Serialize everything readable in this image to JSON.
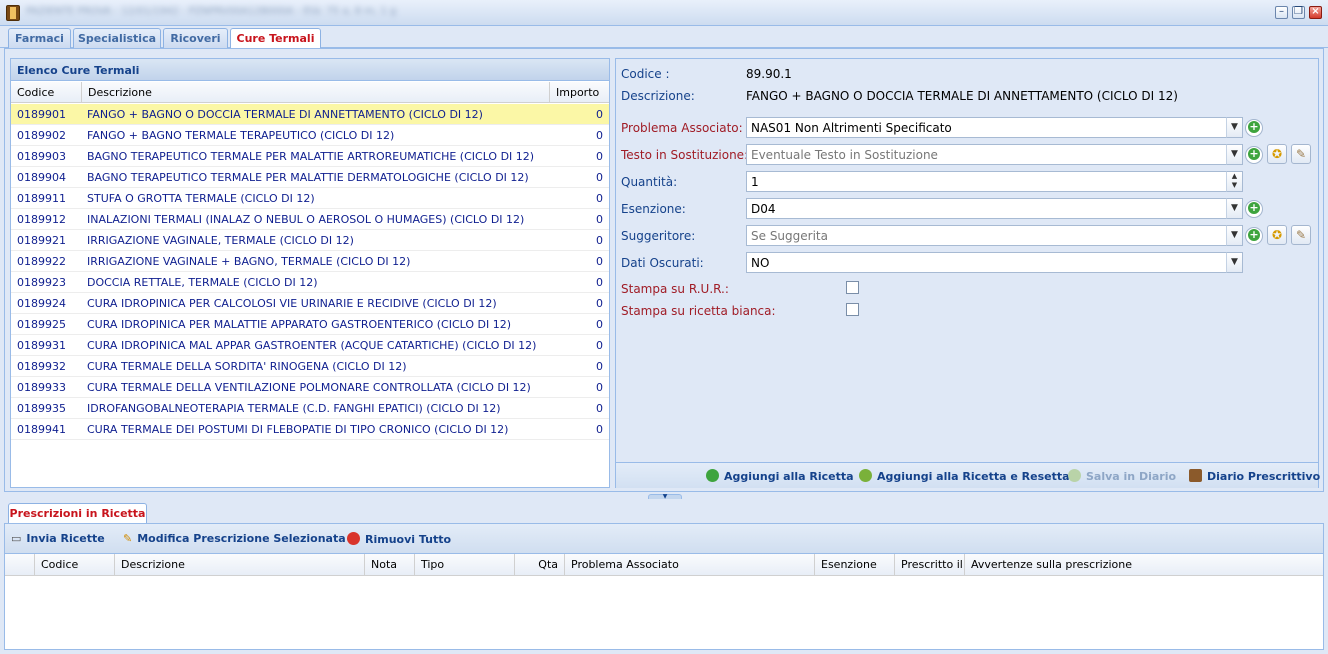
{
  "tabs": [
    "Farmaci",
    "Specialistica",
    "Ricoveri",
    "Cure Termali"
  ],
  "active_tab": "Cure Termali",
  "list": {
    "title": "Elenco Cure Termali",
    "columns": [
      "Codice",
      "Descrizione",
      "Importo"
    ],
    "rows": [
      {
        "codice": "0189901",
        "descrizione": "FANGO + BAGNO O DOCCIA TERMALE DI ANNETTAMENTO (CICLO DI 12)",
        "importo": "0"
      },
      {
        "codice": "0189902",
        "descrizione": "FANGO + BAGNO TERMALE TERAPEUTICO (CICLO DI 12)",
        "importo": "0"
      },
      {
        "codice": "0189903",
        "descrizione": "BAGNO TERAPEUTICO TERMALE PER MALATTIE ARTROREUMATICHE (CICLO DI 12)",
        "importo": "0"
      },
      {
        "codice": "0189904",
        "descrizione": "BAGNO TERAPEUTICO TERMALE PER MALATTIE DERMATOLOGICHE (CICLO DI 12)",
        "importo": "0"
      },
      {
        "codice": "0189911",
        "descrizione": "STUFA O GROTTA TERMALE (CICLO DI 12)",
        "importo": "0"
      },
      {
        "codice": "0189912",
        "descrizione": "INALAZIONI TERMALI (INALAZ O NEBUL O AEROSOL O HUMAGES) (CICLO DI 12)",
        "importo": "0"
      },
      {
        "codice": "0189921",
        "descrizione": "IRRIGAZIONE VAGINALE, TERMALE (CICLO DI 12)",
        "importo": "0"
      },
      {
        "codice": "0189922",
        "descrizione": "IRRIGAZIONE VAGINALE + BAGNO, TERMALE (CICLO DI 12)",
        "importo": "0"
      },
      {
        "codice": "0189923",
        "descrizione": "DOCCIA RETTALE, TERMALE (CICLO DI 12)",
        "importo": "0"
      },
      {
        "codice": "0189924",
        "descrizione": "CURA IDROPINICA PER CALCOLOSI VIE URINARIE E RECIDIVE (CICLO DI 12)",
        "importo": "0"
      },
      {
        "codice": "0189925",
        "descrizione": "CURA IDROPINICA PER MALATTIE APPARATO GASTROENTERICO (CICLO DI 12)",
        "importo": "0"
      },
      {
        "codice": "0189931",
        "descrizione": "CURA IDROPINICA MAL APPAR GASTROENTER (ACQUE CATARTICHE) (CICLO DI 12)",
        "importo": "0"
      },
      {
        "codice": "0189932",
        "descrizione": "CURA TERMALE DELLA SORDITA' RINOGENA (CICLO DI 12)",
        "importo": "0"
      },
      {
        "codice": "0189933",
        "descrizione": "CURA TERMALE DELLA VENTILAZIONE POLMONARE CONTROLLATA (CICLO DI 12)",
        "importo": "0"
      },
      {
        "codice": "0189935",
        "descrizione": "IDROFANGOBALNEOTERAPIA TERMALE (C.D. FANGHI EPATICI) (CICLO DI 12)",
        "importo": "0"
      },
      {
        "codice": "0189941",
        "descrizione": "CURA TERMALE DEI POSTUMI DI FLEBOPATIE DI TIPO CRONICO (CICLO DI 12)",
        "importo": "0"
      }
    ]
  },
  "detail": {
    "codice_label": "Codice :",
    "codice_value": "89.90.1",
    "descrizione_label": "Descrizione:",
    "descrizione_value": "FANGO + BAGNO O DOCCIA TERMALE DI ANNETTAMENTO (CICLO DI 12)",
    "problema_label": "Problema Associato:",
    "problema_value": "NAS01 Non Altrimenti Specificato",
    "testo_label": "Testo in Sostituzione:",
    "testo_placeholder": "Eventuale Testo in Sostituzione",
    "quantita_label": "Quantità:",
    "quantita_value": "1",
    "esenzione_label": "Esenzione:",
    "esenzione_value": "D04",
    "suggeritore_label": "Suggeritore:",
    "suggeritore_placeholder": "Se Suggerita",
    "dati_label": "Dati Oscurati:",
    "dati_value": "NO",
    "stampa_rur_label": "Stampa su R.U.R.:",
    "stampa_bianca_label": "Stampa su ricetta bianca:"
  },
  "actions": {
    "aggiungi": "Aggiungi alla Ricetta",
    "aggiungi_reset": "Aggiungi alla Ricetta e Resetta",
    "salva": "Salva in Diario",
    "diario": "Diario Prescrittivo"
  },
  "bottom": {
    "tab": "Prescrizioni in Ricetta",
    "toolbar": {
      "invia": "Invia Ricette",
      "modifica": "Modifica Prescrizione Selezionata",
      "rimuovi": "Rimuovi Tutto"
    },
    "columns": [
      "Codice",
      "Descrizione",
      "Nota",
      "Tipo",
      "Qta",
      "Problema Associato",
      "Esenzione",
      "Prescritto il",
      "Avvertenze sulla prescrizione"
    ]
  },
  "colors": {
    "accent_red": "#c8141c",
    "selected_row": "#fbf7a6",
    "panel_blue": "#dfe8f6"
  }
}
